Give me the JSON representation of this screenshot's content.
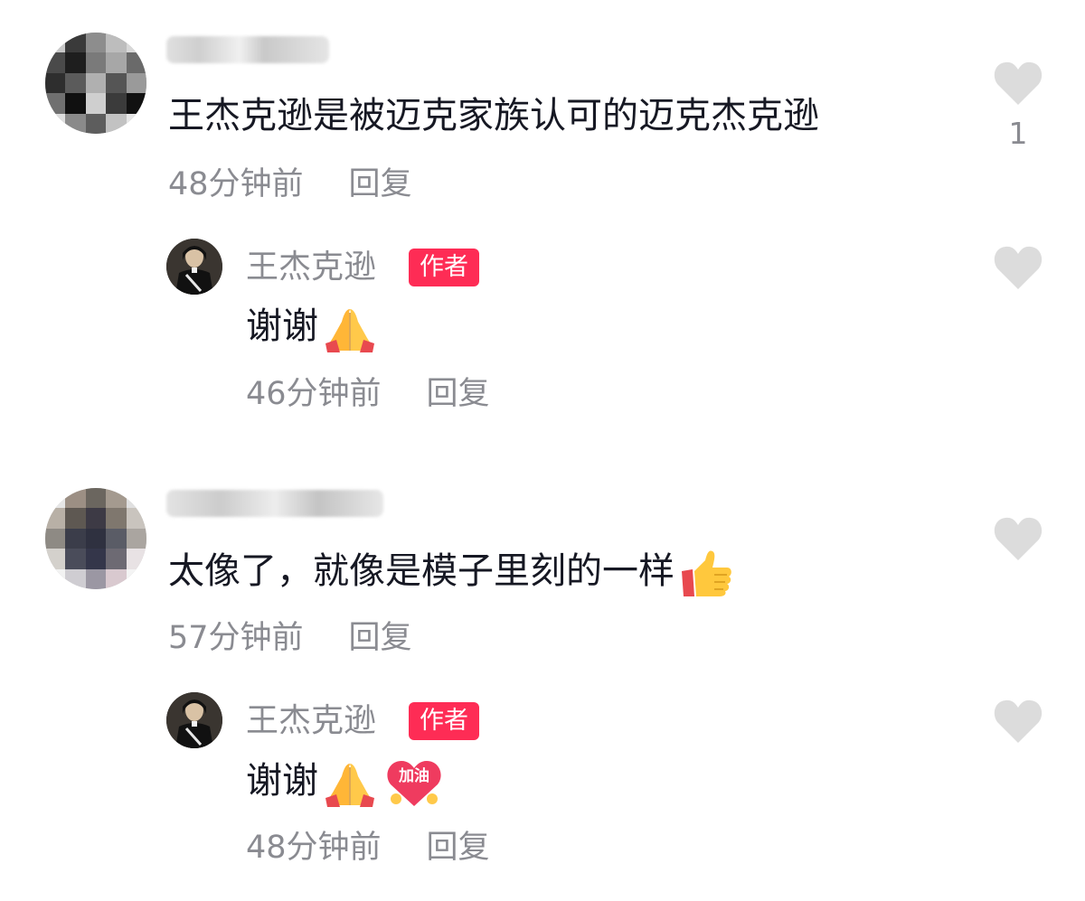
{
  "comments": [
    {
      "text": "王杰克逊是被迈克家族认可的迈克杰克逊",
      "time": "48分钟前",
      "reply_label": "回复",
      "like_count": "1",
      "icons": [
        "heart-icon"
      ]
    },
    {
      "author": "王杰克逊",
      "badge": "作者",
      "text": "谢谢",
      "emojis": [
        "folded-hands-emoji"
      ],
      "time": "46分钟前",
      "reply_label": "回复",
      "icons": [
        "heart-icon"
      ]
    },
    {
      "text": "太像了，就像是模子里刻的一样",
      "emojis": [
        "thumbs-up-emoji"
      ],
      "time": "57分钟前",
      "reply_label": "回复",
      "icons": [
        "heart-icon"
      ]
    },
    {
      "author": "王杰克逊",
      "badge": "作者",
      "text": "谢谢",
      "emojis": [
        "folded-hands-emoji",
        "jiayou-heart-sticker"
      ],
      "sticker_text": "加油",
      "time": "48分钟前",
      "reply_label": "回复",
      "icons": [
        "heart-icon"
      ]
    }
  ],
  "colors": {
    "text": "#161823",
    "secondary": "#8a8b91",
    "badge": "#fe2c55",
    "heart": "#dcdcdc"
  }
}
